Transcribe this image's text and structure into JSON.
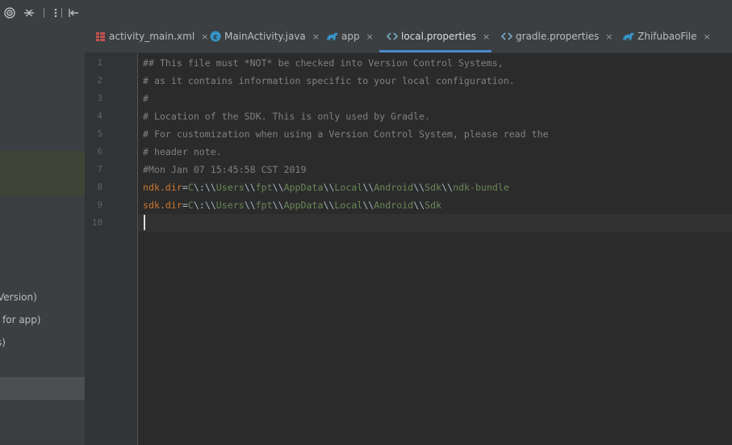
{
  "left_panel": {
    "tree_rows": [
      {
        "text": "Version)"
      },
      {
        "text": "for app)"
      },
      {
        "text": "s)"
      }
    ]
  },
  "tabs": [
    {
      "label": "activity_main.xml",
      "icon": "layout-icon"
    },
    {
      "label": "MainActivity.java",
      "icon": "class-icon"
    },
    {
      "label": "app",
      "icon": "gradle-icon"
    },
    {
      "label": "local.properties",
      "icon": "properties-icon",
      "active": true
    },
    {
      "label": "gradle.properties",
      "icon": "properties-icon"
    },
    {
      "label": "ZhifubaoFile",
      "icon": "gradle-icon"
    }
  ],
  "tab_close_symbol": "×",
  "editor": {
    "line_numbers": [
      "1",
      "2",
      "3",
      "4",
      "5",
      "6",
      "7",
      "8",
      "9",
      "10"
    ],
    "lines": [
      "## This file must *NOT* be checked into Version Control Systems,",
      "# as it contains information specific to your local configuration.",
      "#",
      "# Location of the SDK. This is only used by Gradle.",
      "# For customization when using a Version Control System, please read the",
      "# header note.",
      "#Mon Jan 07 15:45:58 CST 2019",
      {
        "key": "ndk.dir",
        "eq": "=",
        "parts": [
          "C",
          "\\:",
          "\\\\",
          "Users",
          "\\\\",
          "fpt",
          "\\\\",
          "AppData",
          "\\\\",
          "Local",
          "\\\\",
          "Android",
          "\\\\",
          "Sdk",
          "\\\\",
          "ndk-bundle"
        ]
      },
      {
        "key": "sdk.dir",
        "eq": "=",
        "parts": [
          "C",
          "\\:",
          "\\\\",
          "Users",
          "\\\\",
          "fpt",
          "\\\\",
          "AppData",
          "\\\\",
          "Local",
          "\\\\",
          "Android",
          "\\\\",
          "Sdk"
        ]
      },
      ""
    ]
  },
  "colors": {
    "comment": "#808080",
    "key": "#cc7832",
    "value": "#6a8759",
    "active_tab_underline": "#4a88c7"
  }
}
